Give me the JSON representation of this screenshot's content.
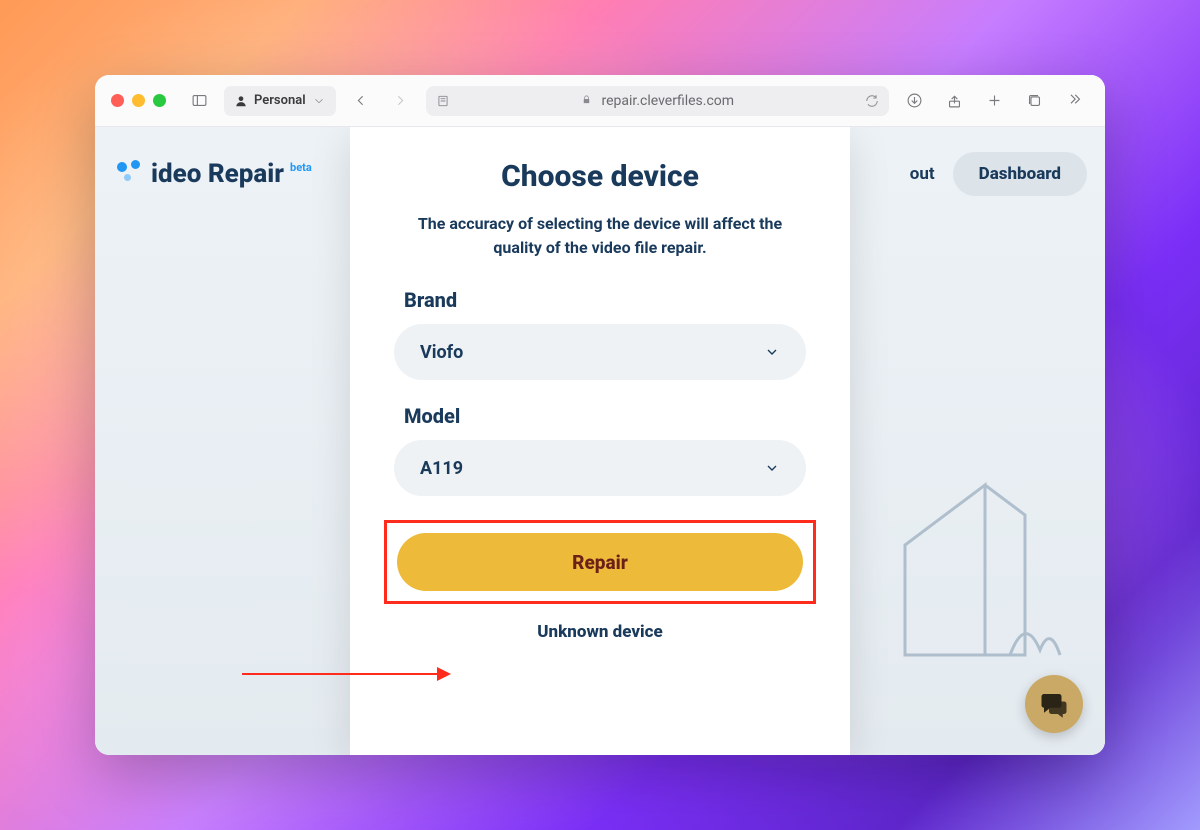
{
  "toolbar": {
    "profile_label": "Personal",
    "url": "repair.cleverfiles.com"
  },
  "app": {
    "logo_text": "ideo Repair",
    "beta_tag": "beta",
    "nav_about": "out",
    "dashboard_label": "Dashboard"
  },
  "modal": {
    "title": "Choose device",
    "subtitle": "The accuracy of selecting the device will affect the quality of the video file repair.",
    "brand_label": "Brand",
    "brand_value": "Viofo",
    "model_label": "Model",
    "model_value": "A119",
    "repair_label": "Repair",
    "unknown_label": "Unknown device"
  }
}
